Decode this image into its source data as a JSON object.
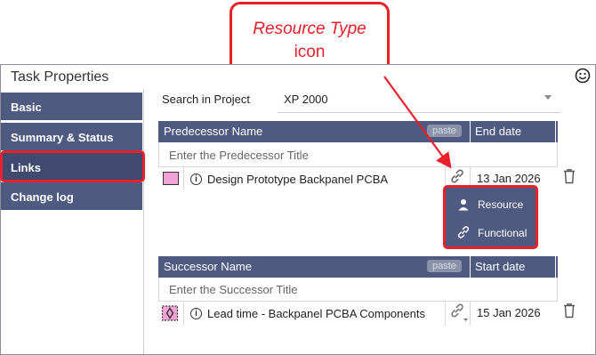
{
  "callout": {
    "line1": "Resource Type",
    "line2": "icon"
  },
  "window": {
    "title": "Task Properties"
  },
  "sidebar": {
    "items": [
      {
        "label": "Basic"
      },
      {
        "label": "Summary & Status"
      },
      {
        "label": "Links",
        "active": true
      },
      {
        "label": "Change log"
      }
    ]
  },
  "search": {
    "label": "Search in Project",
    "value": "XP 2000"
  },
  "predecessor": {
    "col_name": "Predecessor Name",
    "paste": "paste",
    "col_date": "End date",
    "placeholder": "Enter the Predecessor Title",
    "row": {
      "title": "Design Prototype Backpanel PCBA",
      "date": "13 Jan 2026"
    }
  },
  "menu": {
    "items": [
      {
        "label": "Resource",
        "icon": "person-icon"
      },
      {
        "label": "Functional",
        "icon": "link-icon"
      }
    ]
  },
  "successor": {
    "col_name": "Successor Name",
    "paste": "paste",
    "col_date": "Start date",
    "placeholder": "Enter the Successor Title",
    "row": {
      "title": "Lead time - Backpanel PCBA Components",
      "date": "15 Jan 2026"
    }
  },
  "colors": {
    "header": "#4e5a80",
    "highlight": "#e8202a",
    "swatch": "#f5a3d6"
  }
}
